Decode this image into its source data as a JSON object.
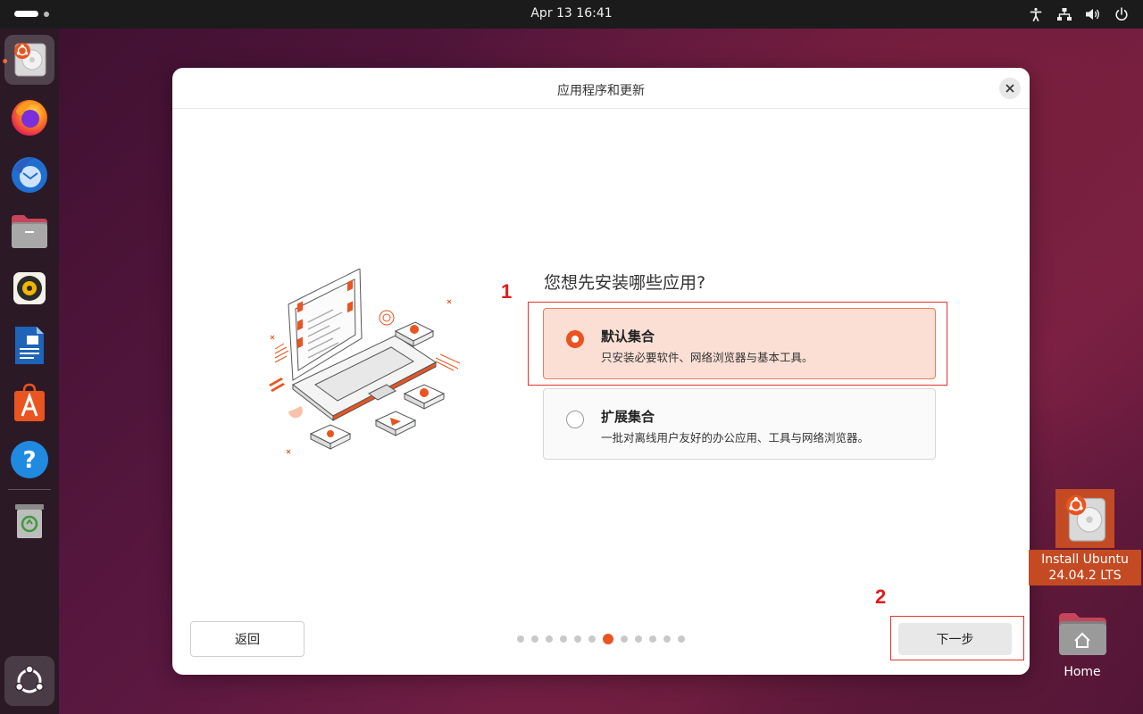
{
  "topbar": {
    "clock": "Apr 13  16:41",
    "tray_icons": [
      "accessibility-icon",
      "network-icon",
      "volume-icon",
      "power-icon"
    ]
  },
  "dock": {
    "items": [
      {
        "name": "install-ubuntu",
        "icon": "installer-disk-icon",
        "active": true
      },
      {
        "name": "firefox",
        "icon": "firefox-icon"
      },
      {
        "name": "thunderbird",
        "icon": "thunderbird-icon"
      },
      {
        "name": "files",
        "icon": "files-icon"
      },
      {
        "name": "rhythmbox",
        "icon": "rhythmbox-icon"
      },
      {
        "name": "libreoffice-writer",
        "icon": "writer-icon"
      },
      {
        "name": "app-center",
        "icon": "app-center-icon"
      },
      {
        "name": "help",
        "icon": "help-icon"
      },
      {
        "name": "trash",
        "icon": "trash-icon"
      }
    ],
    "show_apps_icon": "ubuntu-apps-icon"
  },
  "dialog": {
    "title": "应用程序和更新",
    "question": "您想先安装哪些应用?",
    "options": [
      {
        "title": "默认集合",
        "description": "只安装必要软件、网络浏览器与基本工具。",
        "selected": true
      },
      {
        "title": "扩展集合",
        "description": "一批对离线用户友好的办公应用、工具与网络浏览器。",
        "selected": false
      }
    ],
    "back_label": "返回",
    "next_label": "下一步",
    "pager": {
      "total": 12,
      "current": 7
    }
  },
  "annotations": {
    "label_1": "1",
    "label_2": "2"
  },
  "desktop": {
    "install_label_line1": "Install Ubuntu",
    "install_label_line2": "24.04.2 LTS",
    "home_label": "Home"
  },
  "colors": {
    "accent": "#e95420",
    "selected_bg": "#fbdfd5",
    "annotation": "#e53030"
  }
}
